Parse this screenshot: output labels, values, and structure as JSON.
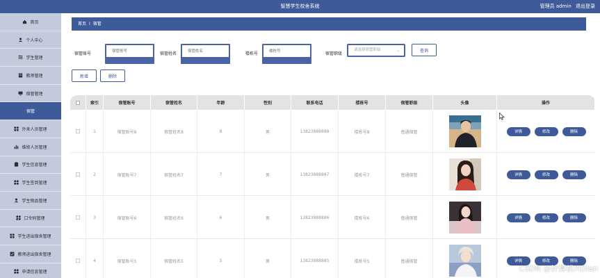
{
  "header": {
    "title": "智慧学生校舍系统",
    "user": "管理员 admin",
    "logout": "退出登录"
  },
  "sidebar": {
    "items": [
      {
        "label": "首页",
        "icon": "home-icon"
      },
      {
        "label": "个人中心",
        "icon": "user-icon"
      },
      {
        "label": "学生管理",
        "icon": "sliders-icon"
      },
      {
        "label": "教师管理",
        "icon": "document-icon"
      },
      {
        "label": "宿管管理",
        "icon": "monitor-icon"
      },
      {
        "label": "宿管",
        "icon": "",
        "active": true
      },
      {
        "label": "外来人员管理",
        "icon": "grid-icon"
      },
      {
        "label": "维修人员管理",
        "icon": "bar-chart-icon"
      },
      {
        "label": "学生信息管理",
        "icon": "clipboard-icon"
      },
      {
        "label": "学生签到管理",
        "icon": "grid-icon"
      },
      {
        "label": "学生物品管理",
        "icon": "user-icon"
      },
      {
        "label": "口令码管理",
        "icon": "grid-icon"
      },
      {
        "label": "学生进出宿舍管理",
        "icon": "grid-icon"
      },
      {
        "label": "教师进出宿舍管理",
        "icon": "check-square-icon"
      },
      {
        "label": "申请信息管理",
        "icon": "grid-icon"
      }
    ]
  },
  "breadcrumb": {
    "home": "首页",
    "separator": "Ⅰ",
    "current": "宿管"
  },
  "search": {
    "fields": [
      {
        "label": "宿管账号",
        "placeholder": "宿管账号"
      },
      {
        "label": "宿管姓名",
        "placeholder": "宿管姓名"
      },
      {
        "label": "楼栋号",
        "placeholder": "楼栋号"
      }
    ],
    "select": {
      "label": "宿管职级",
      "placeholder": "请选择宿管职级"
    },
    "query_label": "查询"
  },
  "actions": {
    "add_label": "新增",
    "delete_label": "删除"
  },
  "table": {
    "columns": [
      "",
      "索引",
      "宿管账号",
      "宿管姓名",
      "年龄",
      "性别",
      "联系电话",
      "楼栋号",
      "宿管职级",
      "头像",
      "操作"
    ],
    "rows": [
      {
        "index": "1",
        "account": "宿管账号8",
        "name": "宿管姓名8",
        "age": "8",
        "gender": "男",
        "phone": "13823888888",
        "building": "楼栋号8",
        "level": "普通宿管",
        "avatar": "avatar-male-dark-jacket"
      },
      {
        "index": "2",
        "account": "宿管账号7",
        "name": "宿管姓名7",
        "age": "7",
        "gender": "男",
        "phone": "13823888887",
        "building": "楼栋号7",
        "level": "普通宿管",
        "avatar": "avatar-female-red-top"
      },
      {
        "index": "3",
        "account": "宿管账号6",
        "name": "宿管姓名6",
        "age": "6",
        "gender": "男",
        "phone": "13823888886",
        "building": "楼栋号6",
        "level": "普通宿管",
        "avatar": "avatar-female-pink-dress"
      },
      {
        "index": "4",
        "account": "宿管账号5",
        "name": "宿管姓名5",
        "age": "5",
        "gender": "男",
        "phone": "13823888885",
        "building": "楼栋号5",
        "level": "普通宿管",
        "avatar": "avatar-male-light-hair"
      }
    ],
    "row_actions": {
      "detail": "详情",
      "edit": "修改",
      "delete": "删除"
    }
  },
  "watermark": "CSDN @计算机YiDian",
  "colors": {
    "primary": "#3f5a99",
    "sidebar": "#c2cadb",
    "table_header": "#e3e3e3"
  }
}
